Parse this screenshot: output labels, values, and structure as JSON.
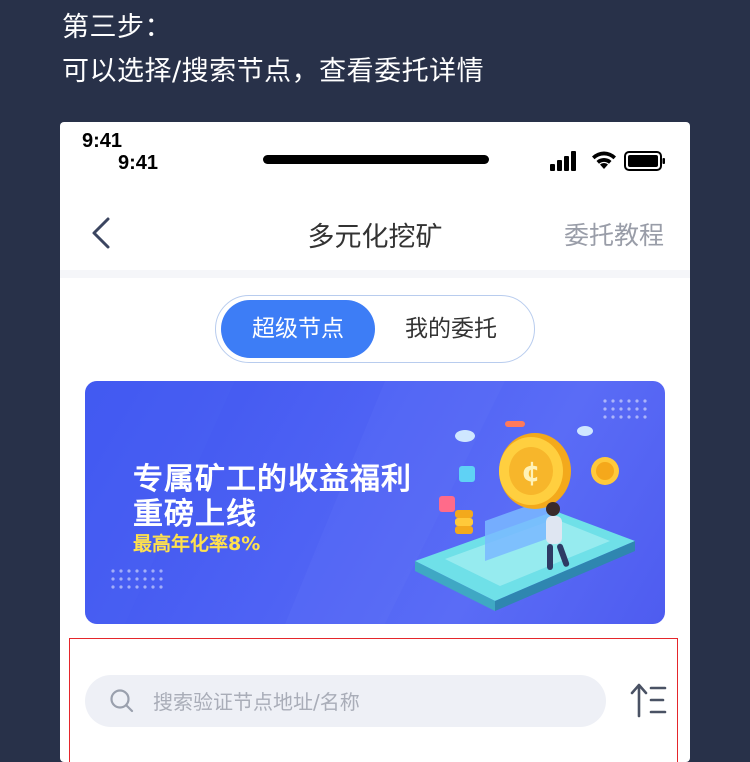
{
  "instruction": {
    "title": "第三步：",
    "description": "可以选择/搜索节点，查看委托详情"
  },
  "status_bar": {
    "time_primary": "9:41",
    "time_secondary": "9:41"
  },
  "nav": {
    "title": "多元化挖矿",
    "action": "委托教程"
  },
  "segmented": {
    "tabs": [
      {
        "label": "超级节点",
        "active": true
      },
      {
        "label": "我的委托",
        "active": false
      }
    ]
  },
  "banner": {
    "title_line1": "专属矿工的收益福利",
    "title_line2": "重磅上线",
    "subtitle": "最高年化率8%"
  },
  "search": {
    "placeholder": "搜索验证节点地址/名称"
  },
  "colors": {
    "page_background": "#283149",
    "accent": "#3d7df6",
    "highlight_outline": "#e5262b",
    "banner_subtitle": "#ffe14d"
  },
  "icons": [
    "back-icon",
    "signal-icon",
    "wifi-icon",
    "battery-icon",
    "search-icon",
    "sort-icon"
  ]
}
